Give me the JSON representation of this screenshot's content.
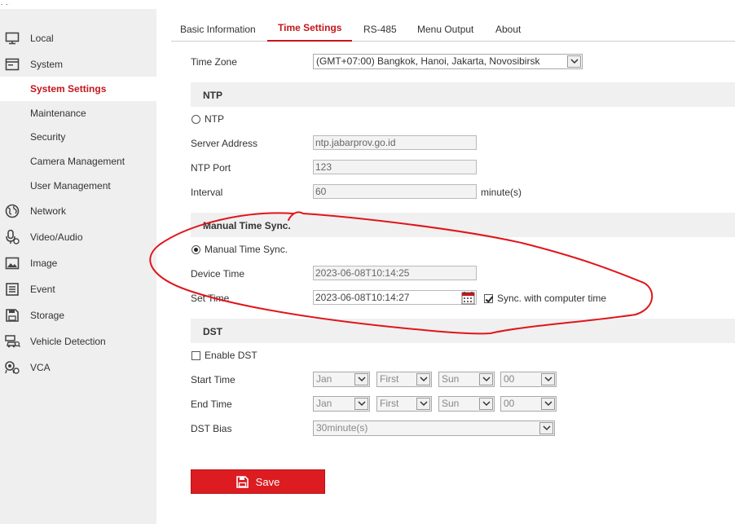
{
  "sidebar": {
    "items": [
      {
        "label": "Local",
        "icon": "monitor-icon"
      },
      {
        "label": "System",
        "icon": "system-window-icon"
      },
      {
        "label": "System Settings"
      },
      {
        "label": "Maintenance"
      },
      {
        "label": "Security"
      },
      {
        "label": "Camera Management"
      },
      {
        "label": "User Management"
      },
      {
        "label": "Network",
        "icon": "globe-icon"
      },
      {
        "label": "Video/Audio",
        "icon": "microphone-icon"
      },
      {
        "label": "Image",
        "icon": "image-icon"
      },
      {
        "label": "Event",
        "icon": "event-list-icon"
      },
      {
        "label": "Storage",
        "icon": "floppy-icon"
      },
      {
        "label": "Vehicle Detection",
        "icon": "vehicle-detection-icon"
      },
      {
        "label": "VCA",
        "icon": "vca-icon"
      }
    ],
    "active_color": "#c4161c"
  },
  "tabs": [
    {
      "label": "Basic Information"
    },
    {
      "label": "Time Settings",
      "active": true
    },
    {
      "label": "RS-485"
    },
    {
      "label": "Menu Output"
    },
    {
      "label": "About"
    }
  ],
  "form": {
    "time_zone_label": "Time Zone",
    "time_zone_value": "(GMT+07:00) Bangkok, Hanoi, Jakarta, Novosibirsk",
    "ntp_section": "NTP",
    "ntp_radio_label": "NTP",
    "server_address_label": "Server Address",
    "server_address_value": "ntp.jabarprov.go.id",
    "ntp_port_label": "NTP Port",
    "ntp_port_value": "123",
    "interval_label": "Interval",
    "interval_value": "60",
    "interval_unit": "minute(s)",
    "manual_section": "Manual Time Sync.",
    "manual_radio_label": "Manual Time Sync.",
    "device_time_label": "Device Time",
    "device_time_value": "2023-06-08T10:14:25",
    "set_time_label": "Set Time",
    "set_time_value": "2023-06-08T10:14:27",
    "sync_label": "Sync. with computer time",
    "dst_section": "DST",
    "enable_dst_label": "Enable DST",
    "start_time_label": "Start Time",
    "start_month": "Jan",
    "start_week": "First",
    "start_day": "Sun",
    "start_hour": "00",
    "end_time_label": "End Time",
    "end_month": "Jan",
    "end_week": "First",
    "end_day": "Sun",
    "end_hour": "00",
    "dst_bias_label": "DST Bias",
    "dst_bias_value": "30minute(s)"
  },
  "save_label": "Save",
  "colors": {
    "accent": "#c4161c",
    "save_button": "#dc1c21",
    "annotation": "#e0151b"
  }
}
